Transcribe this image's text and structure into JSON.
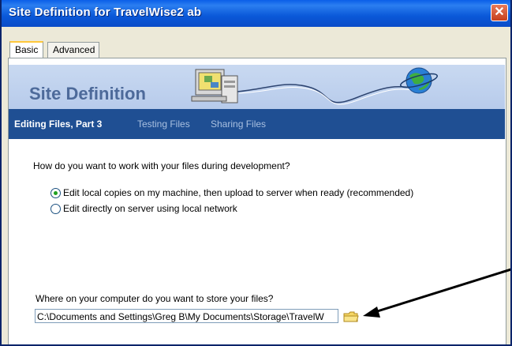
{
  "window": {
    "title": "Site Definition for TravelWise2 ab",
    "close_icon": "close-icon"
  },
  "tabs": [
    {
      "label": "Basic",
      "selected": true
    },
    {
      "label": "Advanced",
      "selected": false
    }
  ],
  "banner": {
    "title": "Site Definition",
    "illustration_icons": [
      "computer-icon",
      "globe-icon"
    ]
  },
  "steps": [
    {
      "label": "Editing Files, Part 3",
      "active": true
    },
    {
      "label": "Testing Files",
      "active": false
    },
    {
      "label": "Sharing Files",
      "active": false
    }
  ],
  "question": "How do you want to work with your files during development?",
  "options": [
    {
      "label": "Edit local copies on my machine, then upload to server when ready (recommended)",
      "selected": true
    },
    {
      "label": "Edit directly on server using local network",
      "selected": false
    }
  ],
  "storage": {
    "prompt": "Where on your computer do you want to store your files?",
    "path_value": "C:\\Documents and Settings\\Greg B\\My Documents\\Storage\\TravelW",
    "browse_icon": "folder-icon"
  },
  "colors": {
    "titlebar": "#0a58d8",
    "stepbar": "#1f4f93",
    "banner": "#c0d3ee",
    "radio_selected": "#21a121"
  }
}
